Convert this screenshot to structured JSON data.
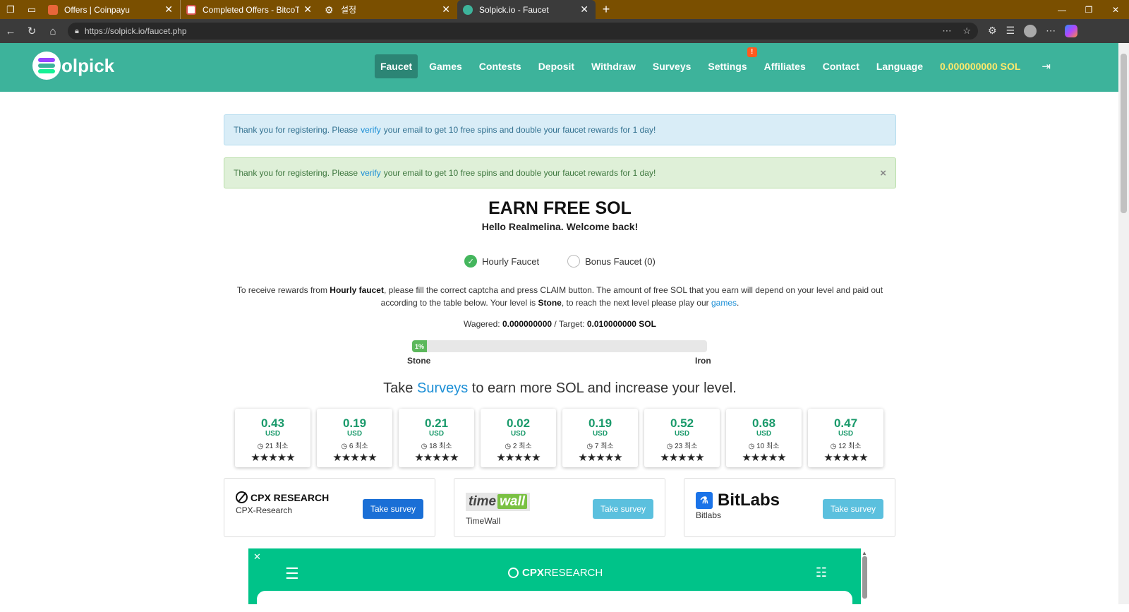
{
  "browser": {
    "tabs": [
      {
        "title": "Offers | Coinpayu",
        "favicon_color": "#e8663a"
      },
      {
        "title": "Completed Offers - BitcoTasks",
        "favicon_color": "#d9534f"
      },
      {
        "title": "설정",
        "favicon_color": "#7a4f00"
      },
      {
        "title": "Solpick.io - Faucet",
        "favicon_color": "#3db39b"
      }
    ],
    "url": "https://solpick.io/faucet.php",
    "theme_color": "#7a4f00"
  },
  "site": {
    "logo_text": "olpick",
    "nav": [
      {
        "label": "Faucet",
        "active": true
      },
      {
        "label": "Games"
      },
      {
        "label": "Contests"
      },
      {
        "label": "Deposit"
      },
      {
        "label": "Withdraw"
      },
      {
        "label": "Surveys"
      },
      {
        "label": "Settings",
        "badge": "!"
      },
      {
        "label": "Affiliates"
      },
      {
        "label": "Contact"
      },
      {
        "label": "Language"
      }
    ],
    "balance": "0.000000000 SOL",
    "accent": "#3db39b"
  },
  "alerts": {
    "info": {
      "before": "Thank you for registering. Please",
      "link": "verify",
      "after": "your email to get 10 free spins and double your faucet rewards for 1 day!"
    },
    "success": {
      "before": "Thank you for registering. Please",
      "link": "verify",
      "after": "your email to get 10 free spins and double your faucet rewards for 1 day!",
      "close": "×"
    }
  },
  "faucet": {
    "title": "EARN FREE SOL",
    "welcome": "Hello Realmelina. Welcome back!",
    "options": [
      {
        "label": "Hourly Faucet",
        "checked": true
      },
      {
        "label": "Bonus Faucet (0)",
        "checked": false
      }
    ],
    "desc": {
      "p1": "To receive rewards from",
      "b1": "Hourly faucet",
      "p2": ", please fill the correct captcha and press CLAIM button. The amount of free SOL that you earn will depend on your level and paid out according to the table below. Your level is",
      "b2": "Stone",
      "p3": ", to reach the next level please play our",
      "link": "games",
      "p4": "."
    },
    "wager": {
      "label1": "Wagered:",
      "wagered": "0.000000000",
      "label2": "/ Target:",
      "target": "0.010000000 SOL"
    },
    "progress": {
      "label": "1%",
      "value": 0.05
    },
    "level_from": "Stone",
    "level_to": "Iron"
  },
  "surveys": {
    "head_before": "Take",
    "head_link": "Surveys",
    "head_after": "to earn more SOL and increase your level.",
    "currency": "USD",
    "cards": [
      {
        "amount": "0.43",
        "duration": "21 최소",
        "stars": "★★★★★"
      },
      {
        "amount": "0.19",
        "duration": "6 최소",
        "stars": "★★★★★"
      },
      {
        "amount": "0.21",
        "duration": "18 최소",
        "stars": "★★★★★"
      },
      {
        "amount": "0.02",
        "duration": "2 최소",
        "stars": "★★★★★"
      },
      {
        "amount": "0.19",
        "duration": "7 최소",
        "stars": "★★★★★"
      },
      {
        "amount": "0.52",
        "duration": "23 최소",
        "stars": "★★★★★"
      },
      {
        "amount": "0.68",
        "duration": "10 최소",
        "stars": "★★★★★"
      },
      {
        "amount": "0.47",
        "duration": "12 최소",
        "stars": "★★★★★"
      }
    ],
    "providers": [
      {
        "logo": "CPX RESEARCH",
        "name": "CPX-Research",
        "button": "Take survey"
      },
      {
        "logo_a": "time",
        "logo_b": "wall",
        "name": "TimeWall",
        "button": "Take survey"
      },
      {
        "logo": "BitLabs",
        "name": "Bitlabs",
        "button": "Take survey"
      }
    ]
  },
  "cpx_widget": {
    "logo_a": "CPX",
    "logo_b": " RESEARCH",
    "color": "#00c389"
  }
}
